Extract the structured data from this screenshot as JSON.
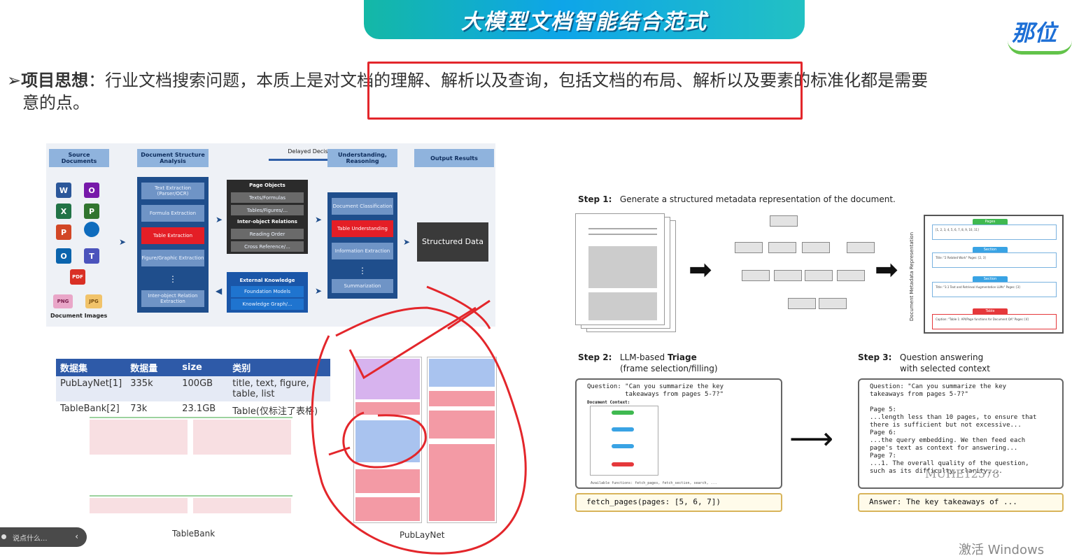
{
  "banner": {
    "title": "大模型文档智能结合范式"
  },
  "logo": {
    "text": "那位"
  },
  "bullet": {
    "mark": "➢",
    "head": "项目思想",
    "sep": "：",
    "text": "行业文档搜索问题，本质上是对文档的理解、解析以及查询，包括文档的布局、解析以及要素的标准化都是需要",
    "text_cont": "意的点。"
  },
  "pipeline": {
    "headers": {
      "source": "Source Documents",
      "dsa": "Document Structure Analysis",
      "delayed": "Delayed Decision",
      "understanding": "Understanding, Reasoning",
      "output": "Output Results"
    },
    "dsa_items": [
      "Text Extraction (Parser/OCR)",
      "Formula Extraction",
      "Table Extraction",
      "Figure/Graphic Extraction",
      "⋮",
      "Inter-object Relation Extraction"
    ],
    "objects_title": "Page Objects",
    "objects_items": [
      "Texts/Formulas",
      "Tables/Figures/..."
    ],
    "relations_title": "Inter-object Relations",
    "relations_items": [
      "Reading Order",
      "Cross Reference/..."
    ],
    "kb_title": "External Knowledge",
    "kb_items": [
      "Foundation Models",
      "Knowledge Graph/..."
    ],
    "und_items": [
      "Document Classification",
      "Table Understanding",
      "Information Extraction",
      "⋮",
      "Summarization"
    ],
    "structured": "Structured Data",
    "doc_images": "Document Images",
    "icons": [
      "W",
      "O",
      "X",
      "P",
      "P",
      "O",
      "T",
      "PDF",
      "PNG",
      "JPG"
    ]
  },
  "dataset_table": {
    "headers": [
      "数据集",
      "数据量",
      "size",
      "类别"
    ],
    "rows": [
      [
        "PubLayNet[1]",
        "335k",
        "100GB",
        "title, text, figure, table, list"
      ],
      [
        "TableBank[2]",
        "73k",
        "23.1GB",
        "Table(仅标注了表格)"
      ]
    ]
  },
  "captions": {
    "tablebank": "TableBank",
    "publaynet": "PubLayNet"
  },
  "steps": {
    "s1_num": "Step 1:",
    "s1_text": "Generate a structured metadata representation of the document.",
    "s2_num": "Step 2:",
    "s2_text_pre": "LLM-based ",
    "s2_text_bold": "Triage",
    "s2_text_line2": "(frame selection/filling)",
    "s3_num": "Step 3:",
    "s3_text": "Question answering",
    "s3_text_line2": "with selected context"
  },
  "metadata": {
    "side_label": "Document Metadata Representation",
    "tags": [
      "Pages",
      "Section",
      "Section",
      "Table"
    ],
    "card_texts": [
      "[1, 2, 3, 4, 5, 6, 7, 8, 9, 10, 11]",
      "Title: \"2 Related Work\"  Pages: [2, 3]",
      "Title: \"3.1 Text and Retrieval Augmentation LLMs\"  Pages: [3]",
      "Caption: \"Table 1: API/Page functions for Document QA\"  Pages: [4]"
    ]
  },
  "step2_box": {
    "question": "Question: \"Can you summarize the key\n          takeaways from pages 5-7?\"",
    "context_label": "Document Context:",
    "functions": "Available functions: fetch_pages, fetch_section, search, ..."
  },
  "step3_box": {
    "text": "Question: \"Can you summarize the key\ntakeaways from pages 5-7?\"\n\nPage 5:\n...length less than 10 pages, to ensure that\nthere is sufficient but not excessive...\nPage 6:\n...the query embedding. We then feed each\npage's text as context for answering...\nPage 7:\n...1. The overall quality of the question,\nsuch as its difficulty, clarity,..."
  },
  "fetch_call": "fetch_pages(pages: [5, 6, 7])",
  "answer": "Answer: The key takeaways of ...",
  "watermark_id": "MUHE12578",
  "chat": {
    "placeholder": "说点什么...",
    "chevron": "‹"
  },
  "windows": "激活 Windows",
  "colors": {
    "accent_red": "#e3262b",
    "blue": "#2e5aa8",
    "teal": "#14b8a6"
  }
}
